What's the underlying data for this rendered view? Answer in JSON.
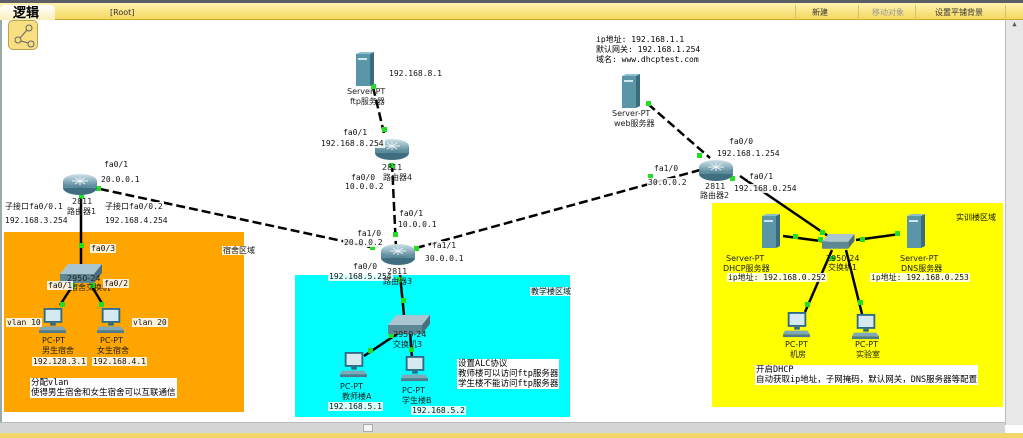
{
  "toolbar": {
    "tab_label": "逻辑",
    "path": "[Root]",
    "new_label": "新建",
    "move_label": "移动对象",
    "tile_bg_label": "设置平铺背景"
  },
  "colors": {
    "dorm_zone": "#FFA500",
    "teaching_zone": "#00FFFF",
    "training_zone": "#FFFF00",
    "link_up": "#22dd22"
  },
  "zones": {
    "dorm": "宿舍区域",
    "teaching": "教学楼区域",
    "training": "实训楼区域"
  },
  "router1": {
    "model": "2811",
    "name": "路由器1",
    "fa01": "fa0/1",
    "fa01_ip": "20.0.0.1",
    "sub1": "子接口fa0/0.1",
    "sub1_ip": "192.168.3.254",
    "sub2": "子接口fa0/0.2",
    "sub2_ip": "192.168.4.254"
  },
  "dorm_switch": {
    "model": "2950-24",
    "name": "宿舍交换机",
    "fa03": "fa0/3",
    "fa01": "fa0/1",
    "fa02": "fa0/2"
  },
  "pc_boys": {
    "model": "PC-PT",
    "name": "男生宿舍",
    "ip": "192.128.3.1",
    "vlan": "vlan 10"
  },
  "pc_girls": {
    "model": "PC-PT",
    "name": "女生宿舍",
    "ip": "192.168.4.1",
    "vlan": "vlan 20"
  },
  "dorm_note": [
    "分配vlan",
    "使得男生宿舍和女生宿舍可以互联通信"
  ],
  "ftp_server": {
    "model": "Server-PT",
    "name": "ftp服务器",
    "ip": "192.168.8.1"
  },
  "router4": {
    "model": "2811",
    "name": "路由器4",
    "fa01": "fa0/1",
    "fa01_ip": "192.168.8.254",
    "fa00": "fa0/0",
    "fa00_ip": "10.0.0.2"
  },
  "router3": {
    "model": "2811",
    "name": "路由器3",
    "fa01": "fa0/1",
    "fa01_ip": "10.0.0.1",
    "fa10": "fa1/0",
    "fa10_ip": "20.0.0.2",
    "fa11": "fa1/1",
    "fa11_ip": "30.0.0.1",
    "fa00": "fa0/0",
    "fa00_ip": "192.168.5.254"
  },
  "switch3": {
    "model": "2950-24",
    "name": "交换机3"
  },
  "pc_teacher": {
    "model": "PC-PT",
    "name": "教师楼A",
    "ip": "192.168.5.1"
  },
  "pc_student": {
    "model": "PC-PT",
    "name": "学生楼B",
    "ip": "192.168.5.2"
  },
  "teaching_note": [
    "设置ALC协议",
    "教师楼可以访问ftp服务器",
    "学生楼不能访问ftp服务器"
  ],
  "web_server": {
    "model": "Server-PT",
    "name": "web服务器",
    "info": [
      "ip地址: 192.168.1.1",
      "默认网关: 192.168.1.254",
      "域名: www.dhcptest.com"
    ]
  },
  "router2": {
    "model": "2811",
    "name": "路由器2",
    "fa00": "fa0/0",
    "fa00_ip": "192.168.1.254",
    "fa10": "fa1/0",
    "fa10_ip": "30.0.0.2",
    "fa01": "fa0/1",
    "fa01_ip": "192.168.0.254"
  },
  "switch1": {
    "model": "2950-24",
    "name": "交换机1"
  },
  "dhcp_server": {
    "model": "Server-PT",
    "name": "DHCP服务器",
    "ip": "ip地址: 192.168.0.252"
  },
  "dns_server": {
    "model": "Server-PT",
    "name": "DNS服务器",
    "ip": "ip地址: 192.168.0.253"
  },
  "pc_lab1": {
    "model": "PC-PT",
    "name": "机房"
  },
  "pc_lab2": {
    "model": "PC-PT",
    "name": "实验室"
  },
  "training_note": [
    "开启DHCP",
    "自动获取ip地址，子网掩码，默认网关，DNS服务器等配置"
  ]
}
